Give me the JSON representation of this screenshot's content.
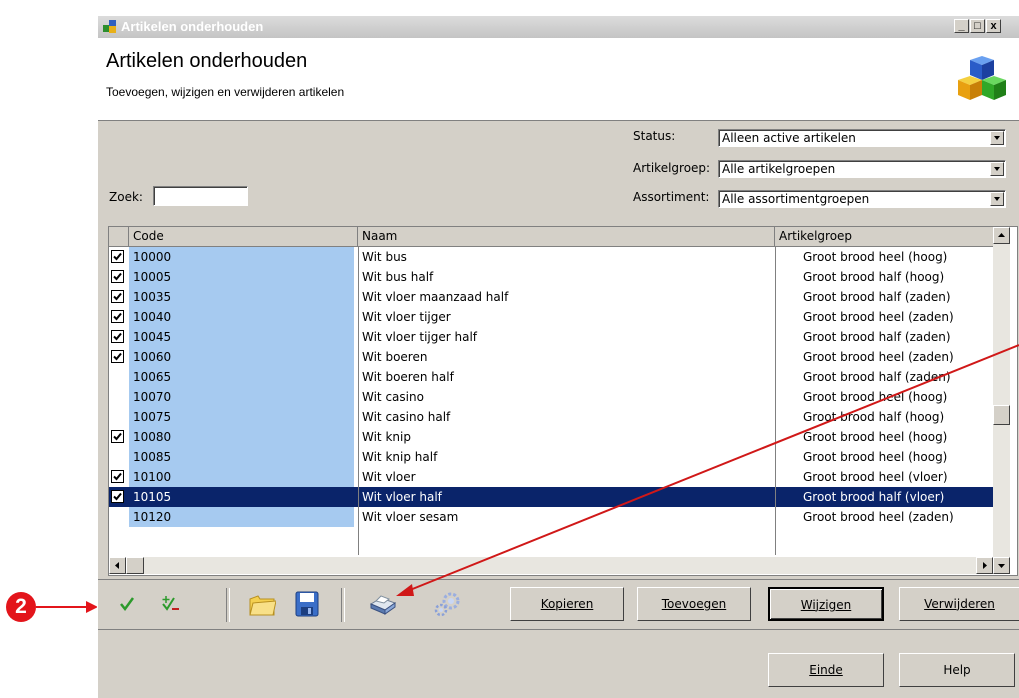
{
  "window": {
    "title": "Artikelen onderhouden",
    "controls": [
      "_",
      "□",
      "x"
    ]
  },
  "header": {
    "title": "Artikelen onderhouden",
    "subtitle": "Toevoegen, wijzigen en verwijderen artikelen",
    "icon": "colored-cubes-icon"
  },
  "filters": {
    "status_label": "Status:",
    "status_value": "Alleen active artikelen",
    "artikelgroep_label": "Artikelgroep:",
    "artikelgroep_value": "Alle artikelgroepen",
    "assortiment_label": "Assortiment:",
    "assortiment_value": "Alle assortimentgroepen",
    "zoek_label": "Zoek:",
    "zoek_value": ""
  },
  "grid": {
    "columns": [
      "Code",
      "Naam",
      "Artikelgroep"
    ],
    "rows": [
      {
        "checked": true,
        "code": "10000",
        "naam": "Wit bus",
        "groep": "Groot brood heel (hoog)"
      },
      {
        "checked": true,
        "code": "10005",
        "naam": "Wit bus half",
        "groep": "Groot brood half (hoog)"
      },
      {
        "checked": true,
        "code": "10035",
        "naam": "Wit vloer maanzaad half",
        "groep": "Groot brood half (zaden)"
      },
      {
        "checked": true,
        "code": "10040",
        "naam": "Wit vloer tijger",
        "groep": "Groot brood heel (zaden)"
      },
      {
        "checked": true,
        "code": "10045",
        "naam": "Wit vloer tijger half",
        "groep": "Groot brood half (zaden)"
      },
      {
        "checked": true,
        "code": "10060",
        "naam": "Wit boeren",
        "groep": "Groot brood heel (zaden)"
      },
      {
        "checked": false,
        "code": "10065",
        "naam": "Wit boeren half",
        "groep": "Groot brood half (zaden)"
      },
      {
        "checked": false,
        "code": "10070",
        "naam": "Wit casino",
        "groep": "Groot brood heel (hoog)"
      },
      {
        "checked": false,
        "code": "10075",
        "naam": "Wit casino half",
        "groep": "Groot brood half (hoog)"
      },
      {
        "checked": true,
        "code": "10080",
        "naam": "Wit knip",
        "groep": "Groot brood heel (hoog)"
      },
      {
        "checked": false,
        "code": "10085",
        "naam": "Wit knip half",
        "groep": "Groot brood heel (hoog)"
      },
      {
        "checked": true,
        "code": "10100",
        "naam": "Wit vloer",
        "groep": "Groot brood heel (vloer)"
      },
      {
        "checked": true,
        "code": "10105",
        "naam": "Wit vloer half",
        "groep": "Groot brood half (vloer)",
        "selected": true
      },
      {
        "checked": false,
        "code": "10120",
        "naam": "Wit vloer sesam",
        "groep": "Groot brood heel (zaden)"
      }
    ]
  },
  "toolbar": {
    "icons": [
      "check-all-icon",
      "check-toggle-icon",
      "folder-icon",
      "save-icon",
      "print-icon",
      "settings-gears-icon"
    ],
    "kopieren": "Kopieren",
    "toevoegen": "Toevoegen",
    "wijzigen": "Wijzigen",
    "verwijderen": "Verwijderen"
  },
  "footer": {
    "einde": "Einde",
    "help": "Help"
  },
  "annotation": {
    "badge": "2",
    "color": "#e3151b"
  },
  "colors": {
    "selection": "#0a246a",
    "code_column": "#a6caf0",
    "face": "#d4d0c8"
  }
}
